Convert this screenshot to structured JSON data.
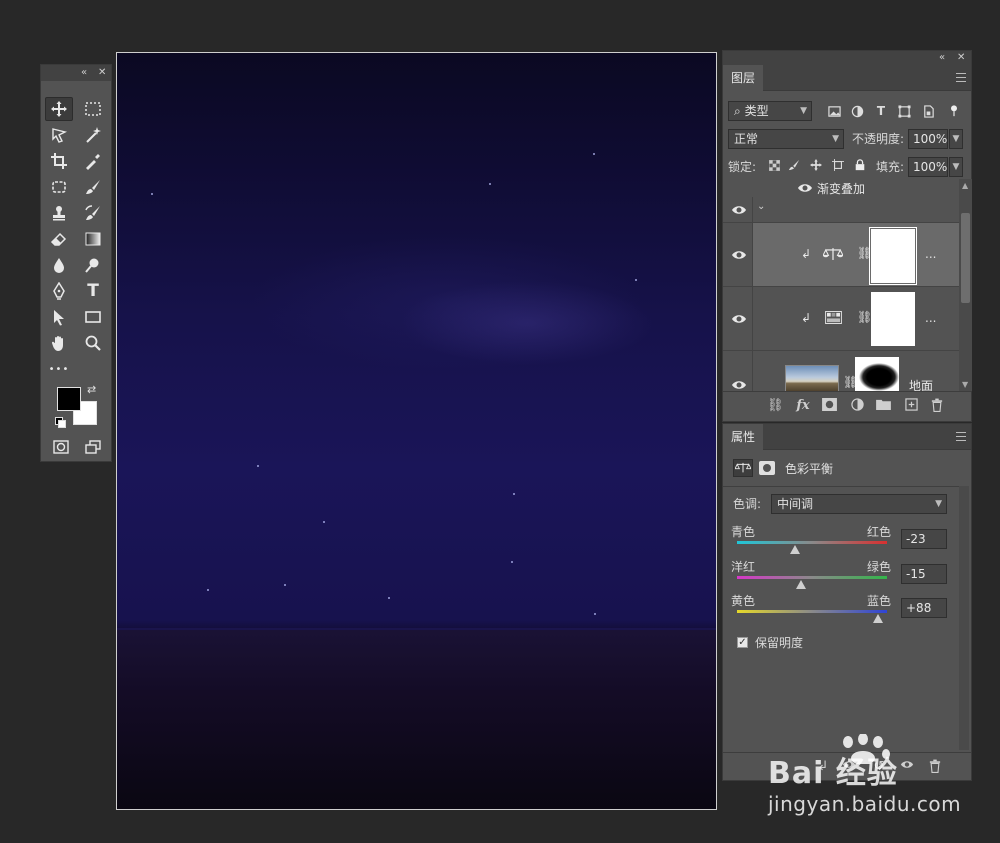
{
  "toolbar": {
    "collapse_glyph": "«",
    "close_glyph": "✕",
    "type_tool_glyph": "T",
    "more_glyph": "•••"
  },
  "canvas": {},
  "layers_panel": {
    "collapse_glyph": "«",
    "close_glyph": "✕",
    "tab_label": "图层",
    "filter_select": "类型",
    "filter_icon_search": "⌕",
    "blend_mode": "正常",
    "opacity_label": "不透明度:",
    "opacity_value": "100%",
    "lock_label": "锁定:",
    "fill_label": "填充:",
    "fill_value": "100%",
    "effect_label": "渐变叠加",
    "layers": [
      {
        "name": "",
        "type": "group-toggle"
      },
      {
        "name": "",
        "type": "color-balance",
        "more": "..."
      },
      {
        "name": "",
        "type": "gradient-map",
        "more": "..."
      },
      {
        "name": "地面",
        "type": "image"
      }
    ],
    "bottom_icons": [
      "link-icon",
      "fx-icon",
      "mask-icon",
      "adjustment-icon",
      "folder-icon",
      "new-layer-icon",
      "trash-icon"
    ],
    "fx_label": "fx"
  },
  "properties_panel": {
    "tab_label": "属性",
    "title": "色彩平衡",
    "tone_label": "色调:",
    "tone_value": "中间调",
    "sliders": [
      {
        "left": "青色",
        "right": "红色",
        "value": "-23",
        "level": -23
      },
      {
        "left": "洋红",
        "right": "绿色",
        "value": "-15",
        "level": -15
      },
      {
        "left": "黄色",
        "right": "蓝色",
        "value": "+88",
        "level": 88
      }
    ],
    "preserve_label": "保留明度",
    "preserve_checked": true
  },
  "watermark": {
    "line1": "Bai 经验",
    "line2": "jingyan.baidu.com"
  },
  "colors": {
    "ui_bg": "#282828",
    "panel_bg": "#535353",
    "panel_dark": "#424242",
    "sky": "#1a1558"
  }
}
